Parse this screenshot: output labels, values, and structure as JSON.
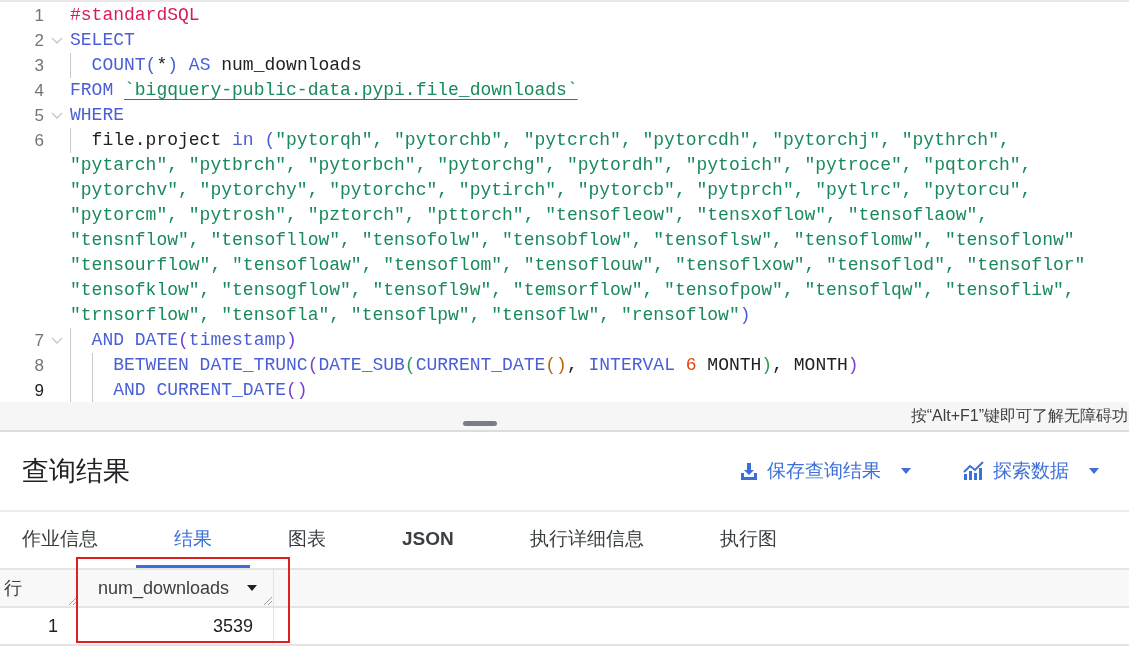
{
  "editor": {
    "lines": [
      {
        "number": "1",
        "foldable": false,
        "current": false,
        "rows": [
          {
            "tokens": [
              {
                "kind": "comment",
                "text": "#standardSQL"
              }
            ]
          }
        ]
      },
      {
        "number": "2",
        "foldable": true,
        "current": false,
        "rows": [
          {
            "tokens": [
              {
                "kind": "keyword",
                "text": "SELECT"
              }
            ]
          }
        ]
      },
      {
        "number": "3",
        "foldable": false,
        "current": false,
        "rows": [
          {
            "tokens": [
              {
                "kind": "keyword",
                "text": "  COUNT"
              },
              {
                "kind": "bracket1",
                "text": "("
              },
              {
                "kind": "plain",
                "text": "*"
              },
              {
                "kind": "bracket1",
                "text": ")"
              },
              {
                "kind": "keyword",
                "text": " AS "
              },
              {
                "kind": "plain",
                "text": "num_downloads"
              }
            ]
          }
        ]
      },
      {
        "number": "4",
        "foldable": false,
        "current": false,
        "rows": [
          {
            "tokens": [
              {
                "kind": "keyword",
                "text": "FROM "
              },
              {
                "kind": "table",
                "text": "`bigquery-public-data.pypi.file_downloads`"
              }
            ]
          }
        ]
      },
      {
        "number": "5",
        "foldable": true,
        "current": false,
        "rows": [
          {
            "tokens": [
              {
                "kind": "keyword",
                "text": "WHERE"
              }
            ]
          }
        ]
      },
      {
        "number": "6",
        "foldable": false,
        "current": false,
        "rows": [
          {
            "tokens": [
              {
                "kind": "plain",
                "text": "  file.project"
              },
              {
                "kind": "keyword",
                "text": " in "
              },
              {
                "kind": "bracket1",
                "text": "("
              },
              {
                "kind": "string",
                "text": "\"pytorqh\", \"pytorchb\", \"pytcrch\", \"pytorcdh\", \"pytorchj\", \"pythrch\","
              }
            ]
          },
          {
            "tokens": [
              {
                "kind": "string",
                "text": "\"pytarch\", \"pytbrch\", \"pytorbch\", \"pytorchg\", \"pytordh\", \"pytoich\", \"pytroce\", \"pqtorch\","
              }
            ]
          },
          {
            "tokens": [
              {
                "kind": "string",
                "text": "\"pytorchv\", \"pytorchy\", \"pytorchc\", \"pytirch\", \"pytorcb\", \"pytprch\", \"pytlrc\", \"pytorcu\","
              }
            ]
          },
          {
            "tokens": [
              {
                "kind": "string",
                "text": "\"pytorcm\", \"pytrosh\", \"pztorch\", \"pttorch\", \"tensofleow\", \"tensxoflow\", \"tensoflaow\","
              }
            ]
          },
          {
            "tokens": [
              {
                "kind": "string",
                "text": "\"tensnflow\", \"tensofllow\", \"tensofolw\", \"tensobflow\", \"tensoflsw\", \"tensoflomw\", \"tensoflonw\""
              }
            ]
          },
          {
            "tokens": [
              {
                "kind": "string",
                "text": "\"tensourflow\", \"tensofloaw\", \"tensoflom\", \"tensoflouw\", \"tensoflxow\", \"tensoflod\", \"tensoflor\""
              }
            ]
          },
          {
            "tokens": [
              {
                "kind": "string",
                "text": "\"tensofklow\", \"tensogflow\", \"tensofl9w\", \"temsorflow\", \"tensofpow\", \"tensoflqw\", \"tensofliw\","
              }
            ]
          },
          {
            "tokens": [
              {
                "kind": "string",
                "text": "\"trnsorflow\", \"tensofla\", \"tensoflpw\", \"tensoflw\", \"rensoflow\""
              },
              {
                "kind": "bracket1",
                "text": ")"
              }
            ]
          }
        ]
      },
      {
        "number": "7",
        "foldable": true,
        "current": false,
        "rows": [
          {
            "tokens": [
              {
                "kind": "keyword",
                "text": "  AND DATE"
              },
              {
                "kind": "bracket2",
                "text": "("
              },
              {
                "kind": "keyword",
                "text": "timestamp"
              },
              {
                "kind": "bracket2",
                "text": ")"
              }
            ]
          }
        ]
      },
      {
        "number": "8",
        "foldable": false,
        "current": false,
        "rows": [
          {
            "tokens": [
              {
                "kind": "keyword",
                "text": "    BETWEEN DATE_TRUNC"
              },
              {
                "kind": "bracket2",
                "text": "("
              },
              {
                "kind": "keyword",
                "text": "DATE_SUB"
              },
              {
                "kind": "bracket3",
                "text": "("
              },
              {
                "kind": "keyword",
                "text": "CURRENT_DATE"
              },
              {
                "kind": "bracket4",
                "text": "()"
              },
              {
                "kind": "plain",
                "text": ", "
              },
              {
                "kind": "keyword",
                "text": "INTERVAL "
              },
              {
                "kind": "number",
                "text": "6"
              },
              {
                "kind": "plain",
                "text": " MONTH"
              },
              {
                "kind": "bracket3",
                "text": ")"
              },
              {
                "kind": "plain",
                "text": ", MONTH"
              },
              {
                "kind": "bracket2",
                "text": ")"
              }
            ]
          }
        ]
      },
      {
        "number": "9",
        "foldable": false,
        "current": true,
        "rows": [
          {
            "tokens": [
              {
                "kind": "keyword",
                "text": "    AND CURRENT_DATE"
              },
              {
                "kind": "bracket2",
                "text": "()"
              }
            ]
          }
        ]
      }
    ],
    "hint": "按“Alt+F1”键即可了解无障碍功"
  },
  "results": {
    "title": "查询结果",
    "actions": [
      {
        "kind": "save",
        "label": "保存查询结果"
      },
      {
        "kind": "explore",
        "label": "探索数据"
      }
    ],
    "tabs": [
      {
        "label": "作业信息",
        "selected": false
      },
      {
        "label": "结果",
        "selected": true
      },
      {
        "label": "图表",
        "selected": false
      },
      {
        "label": "JSON",
        "selected": false
      },
      {
        "label": "执行详细信息",
        "selected": false
      },
      {
        "label": "执行图",
        "selected": false
      }
    ],
    "table": {
      "row_header": "行",
      "columns": [
        {
          "name": "num_downloads",
          "highlighted": true
        }
      ],
      "rows": [
        {
          "number": "1",
          "cells": [
            "3539"
          ]
        }
      ]
    }
  }
}
